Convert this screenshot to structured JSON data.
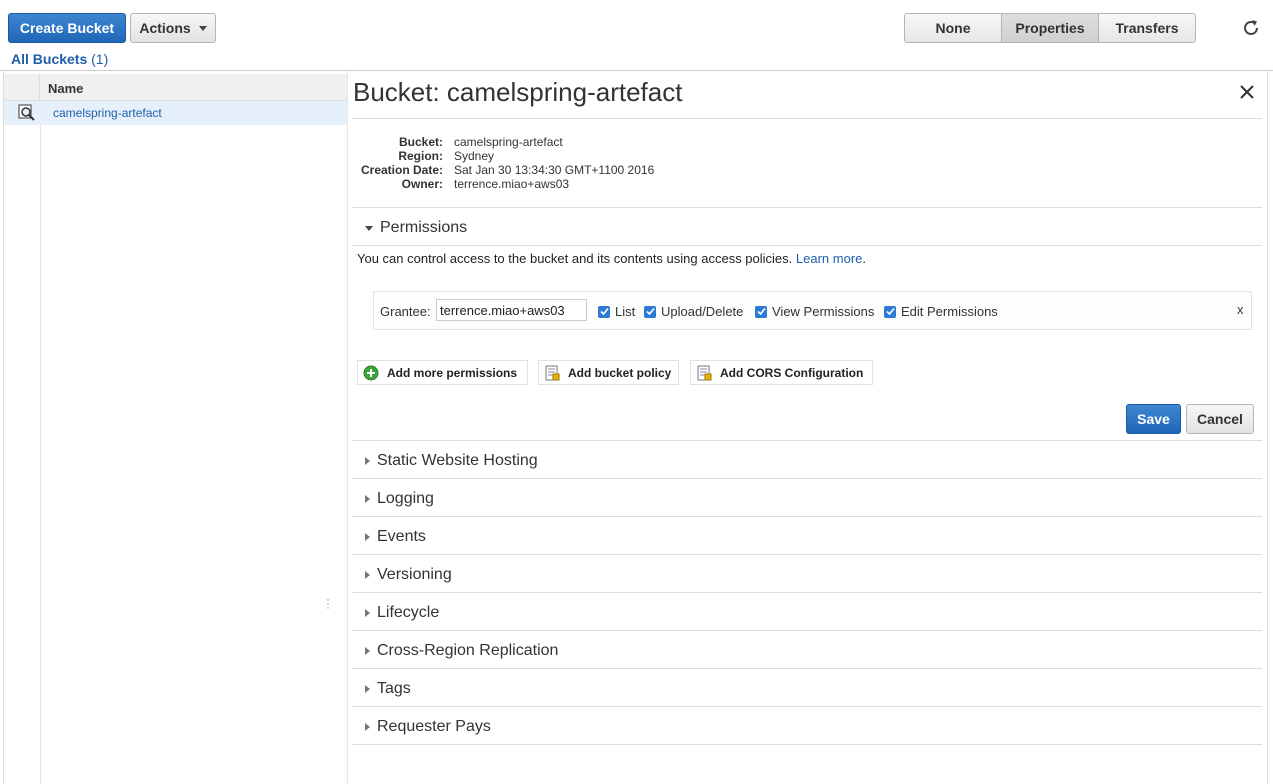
{
  "toolbar": {
    "create_label": "Create Bucket",
    "actions_label": "Actions",
    "view_tabs": [
      "None",
      "Properties",
      "Transfers"
    ],
    "active_tab": "Properties"
  },
  "all_buckets": {
    "label": "All Buckets",
    "count": "(1)"
  },
  "bucket_list": {
    "column_header": "Name",
    "rows": [
      {
        "name": "camelspring-artefact",
        "icon": "magnifier-icon"
      }
    ]
  },
  "detail": {
    "title": "Bucket: camelspring-artefact",
    "properties": [
      {
        "label": "Bucket:",
        "value": "camelspring-artefact"
      },
      {
        "label": "Region:",
        "value": "Sydney"
      },
      {
        "label": "Creation Date:",
        "value": "Sat Jan 30 13:34:30 GMT+1100 2016"
      },
      {
        "label": "Owner:",
        "value": "terrence.miao+aws03"
      }
    ]
  },
  "permissions": {
    "heading": "Permissions",
    "description": "You can control access to the bucket and its contents using access policies.",
    "learn_more": "Learn more",
    "grantee_label": "Grantee:",
    "grantee_value": "terrence.miao+aws03",
    "checkboxes": [
      {
        "label": "List",
        "checked": true
      },
      {
        "label": "Upload/Delete",
        "checked": true
      },
      {
        "label": "View Permissions",
        "checked": true
      },
      {
        "label": "Edit Permissions",
        "checked": true
      }
    ],
    "remove_label": "x",
    "add_more": "Add more permissions",
    "add_policy": "Add bucket policy",
    "add_cors": "Add CORS Configuration",
    "save_label": "Save",
    "cancel_label": "Cancel"
  },
  "sections": [
    "Static Website Hosting",
    "Logging",
    "Events",
    "Versioning",
    "Lifecycle",
    "Cross-Region Replication",
    "Tags",
    "Requester Pays"
  ],
  "colors": {
    "primary_blue": "#1f66b8",
    "link_blue": "#1f5eab",
    "selected_row": "#e6f0fb"
  }
}
